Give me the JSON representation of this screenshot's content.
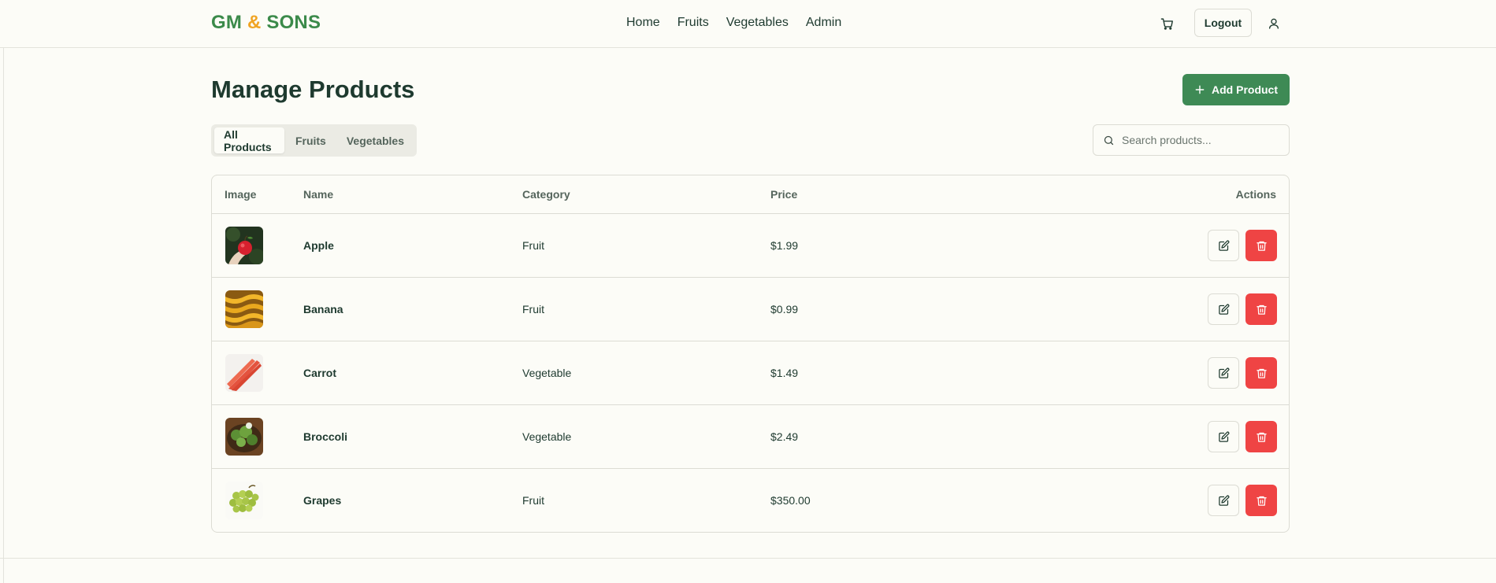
{
  "brand": {
    "part1": "GM",
    "amp": "&",
    "part2": "SONS"
  },
  "nav": {
    "links": [
      "Home",
      "Fruits",
      "Vegetables",
      "Admin"
    ],
    "logout_label": "Logout"
  },
  "page": {
    "title": "Manage Products",
    "add_label": "Add Product"
  },
  "tabs": [
    {
      "label": "All Products",
      "active": true
    },
    {
      "label": "Fruits",
      "active": false
    },
    {
      "label": "Vegetables",
      "active": false
    }
  ],
  "search": {
    "placeholder": "Search products...",
    "value": ""
  },
  "table": {
    "columns": [
      "Image",
      "Name",
      "Category",
      "Price",
      "Actions"
    ],
    "rows": [
      {
        "name": "Apple",
        "category": "Fruit",
        "price": "$1.99",
        "image": "apple"
      },
      {
        "name": "Banana",
        "category": "Fruit",
        "price": "$0.99",
        "image": "banana"
      },
      {
        "name": "Carrot",
        "category": "Vegetable",
        "price": "$1.49",
        "image": "carrot"
      },
      {
        "name": "Broccoli",
        "category": "Vegetable",
        "price": "$2.49",
        "image": "broccoli"
      },
      {
        "name": "Grapes",
        "category": "Fruit",
        "price": "$350.00",
        "image": "grapes"
      }
    ]
  },
  "icons": {
    "cart": "cart-icon",
    "user": "user-icon",
    "plus": "plus-icon",
    "search": "search-icon",
    "edit": "edit-icon",
    "delete": "trash-icon"
  },
  "colors": {
    "brand_green": "#3b8a4a",
    "brand_amp": "#f0a423",
    "primary_button": "#3e8a55",
    "danger": "#ef4444",
    "background": "#fcfcf7",
    "text": "#1e3a2f",
    "border": "#dcdcd4"
  }
}
